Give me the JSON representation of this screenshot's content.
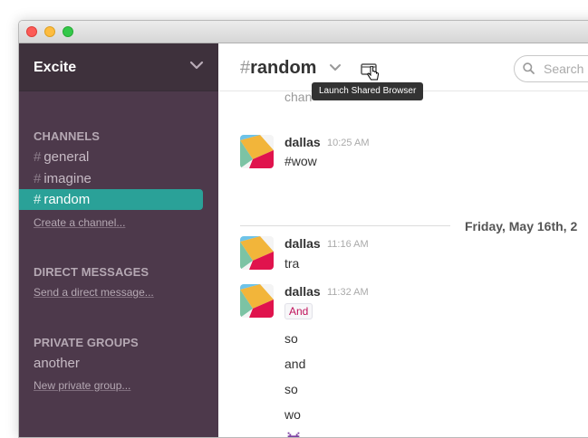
{
  "team": {
    "name": "Excite"
  },
  "sidebar": {
    "channels_header": "CHANNELS",
    "channels": [
      {
        "hash": "#",
        "name": "general"
      },
      {
        "hash": "#",
        "name": "imagine"
      },
      {
        "hash": "#",
        "name": "random"
      }
    ],
    "create_channel": "Create a channel...",
    "dm_header": "DIRECT MESSAGES",
    "send_dm": "Send a direct message...",
    "groups_header": "PRIVATE GROUPS",
    "groups": [
      {
        "name": "another"
      }
    ],
    "new_group": "New private group..."
  },
  "header": {
    "hash": "#",
    "channel": "random",
    "tooltip": "Launch Shared Browser",
    "search_placeholder": "Search"
  },
  "messages": {
    "clipped_text": "chan",
    "day_divider": "Friday, May 16th, 2",
    "items": [
      {
        "author": "dallas",
        "time": "10:25 AM",
        "text": "#wow"
      },
      {
        "author": "dallas",
        "time": "11:16 AM",
        "text": "tra"
      },
      {
        "author": "dallas",
        "time": "11:32 AM",
        "tag": "And",
        "lines": [
          "so",
          "and",
          "so",
          "wo"
        ]
      }
    ]
  },
  "colors": {
    "sidebar_bg": "#4d394b",
    "team_bg": "#3e313c",
    "active_channel": "#2aa198"
  }
}
